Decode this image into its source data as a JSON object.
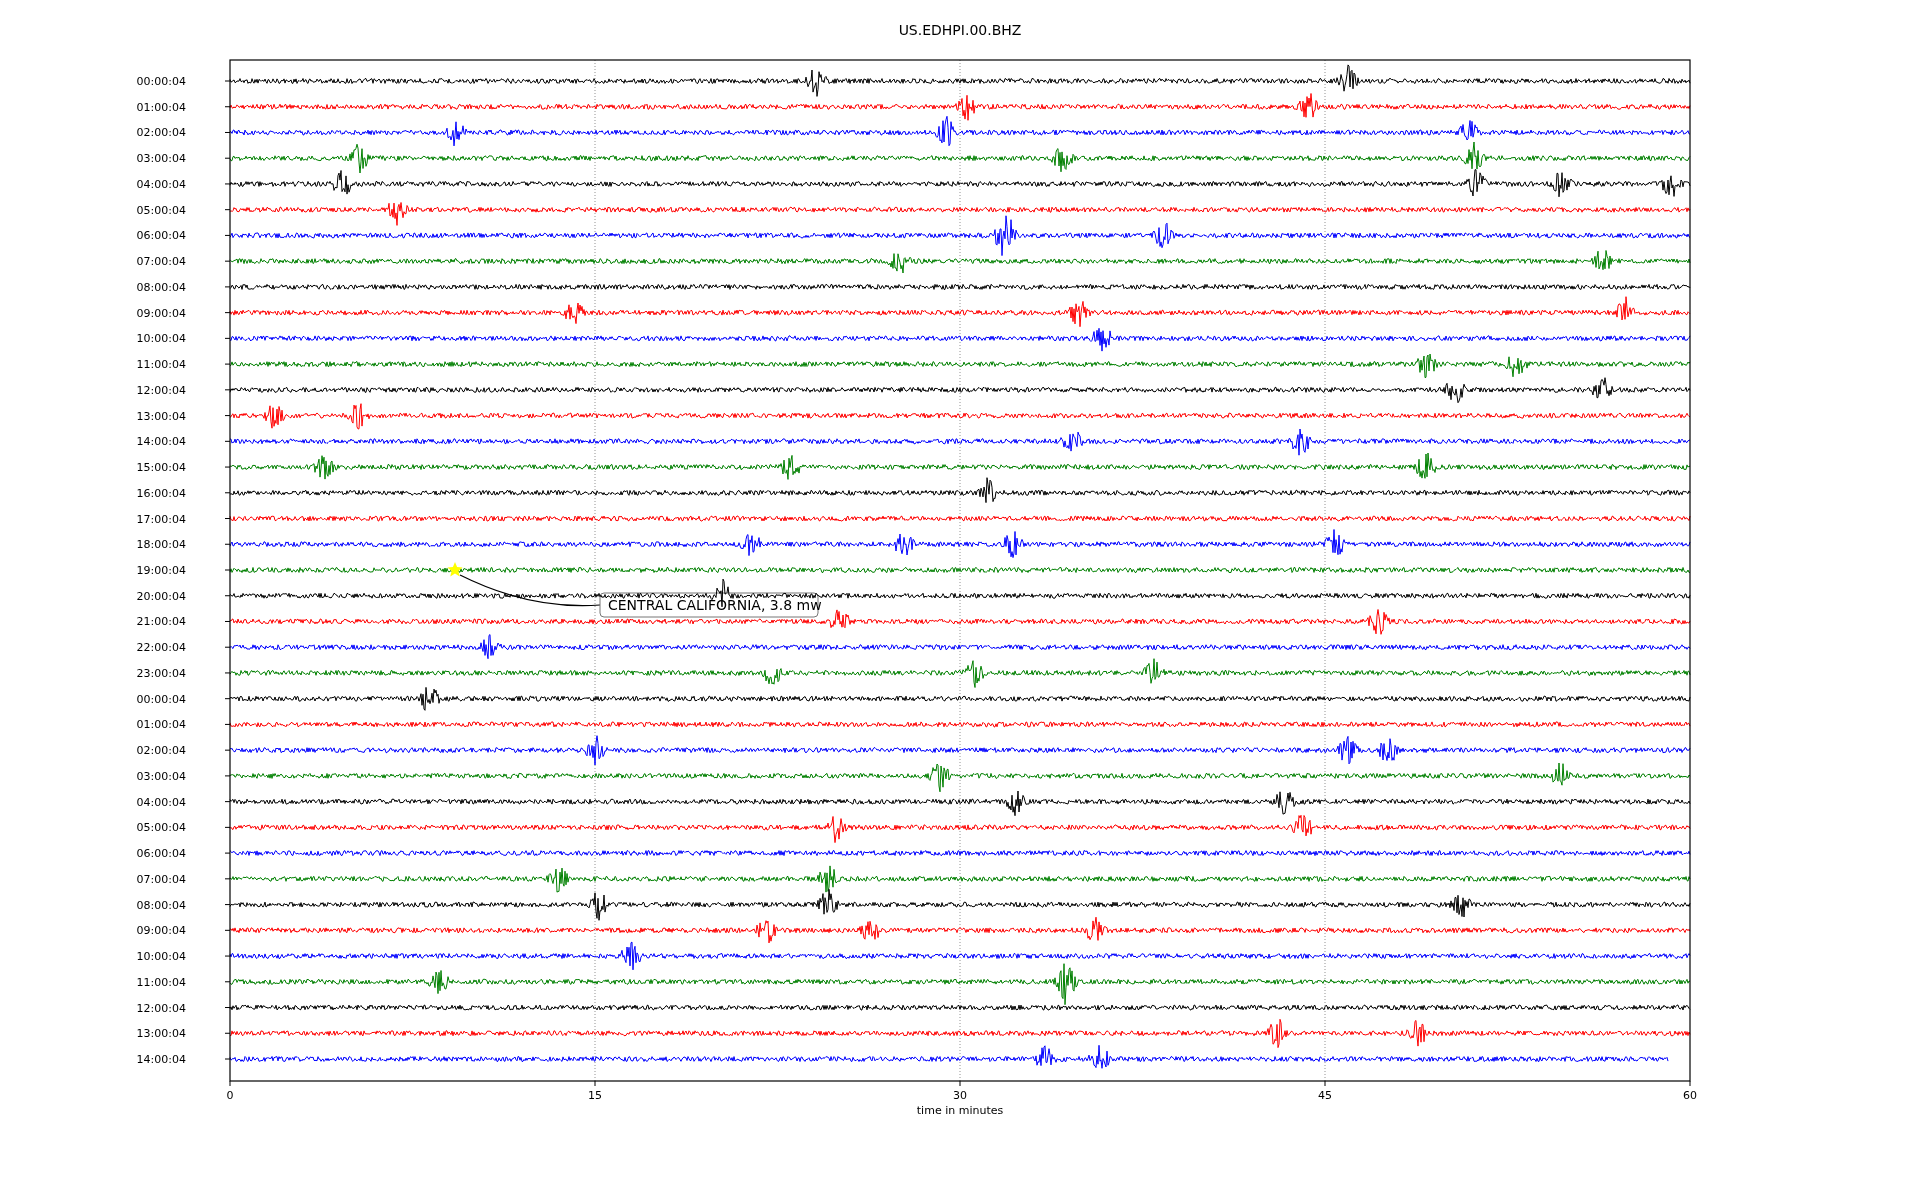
{
  "title": "US.EDHPI.00.BHZ",
  "rows": [
    {
      "label": "00:00:04",
      "color": "#000000"
    },
    {
      "label": "01:00:04",
      "color": "#ff0000"
    },
    {
      "label": "02:00:04",
      "color": "#0000ff"
    },
    {
      "label": "03:00:04",
      "color": "#008000"
    },
    {
      "label": "04:00:04",
      "color": "#000000"
    },
    {
      "label": "05:00:04",
      "color": "#ff0000"
    },
    {
      "label": "06:00:04",
      "color": "#0000ff"
    },
    {
      "label": "07:00:04",
      "color": "#008000"
    },
    {
      "label": "08:00:04",
      "color": "#000000"
    },
    {
      "label": "09:00:04",
      "color": "#ff0000"
    },
    {
      "label": "10:00:04",
      "color": "#0000ff"
    },
    {
      "label": "11:00:04",
      "color": "#008000"
    },
    {
      "label": "12:00:04",
      "color": "#000000"
    },
    {
      "label": "13:00:04",
      "color": "#ff0000"
    },
    {
      "label": "14:00:04",
      "color": "#0000ff"
    },
    {
      "label": "15:00:04",
      "color": "#008000"
    },
    {
      "label": "16:00:04",
      "color": "#000000"
    },
    {
      "label": "17:00:04",
      "color": "#ff0000"
    },
    {
      "label": "18:00:04",
      "color": "#0000ff"
    },
    {
      "label": "19:00:04",
      "color": "#008000",
      "event": "CENTRAL CALIFORNIA, 3.8 mw"
    },
    {
      "label": "20:00:04",
      "color": "#000000"
    },
    {
      "label": "21:00:04",
      "color": "#ff0000"
    },
    {
      "label": "22:00:04",
      "color": "#0000ff"
    },
    {
      "label": "23:00:04",
      "color": "#008000"
    },
    {
      "label": "00:00:04",
      "color": "#000000"
    },
    {
      "label": "01:00:04",
      "color": "#ff0000"
    },
    {
      "label": "02:00:04",
      "color": "#0000ff"
    },
    {
      "label": "03:00:04",
      "color": "#008000"
    },
    {
      "label": "04:00:04",
      "color": "#000000"
    },
    {
      "label": "05:00:04",
      "color": "#ff0000"
    },
    {
      "label": "06:00:04",
      "color": "#0000ff"
    },
    {
      "label": "07:00:04",
      "color": "#008000"
    },
    {
      "label": "08:00:04",
      "color": "#000000"
    },
    {
      "label": "09:00:04",
      "color": "#ff0000"
    },
    {
      "label": "10:00:04",
      "color": "#0000ff"
    },
    {
      "label": "11:00:04",
      "color": "#008000"
    },
    {
      "label": "12:00:04",
      "color": "#000000"
    },
    {
      "label": "13:00:04",
      "color": "#ff0000"
    },
    {
      "label": "14:00:04",
      "color": "#0000ff"
    }
  ],
  "x_ticks": [
    "0",
    "15",
    "30",
    "45",
    "60"
  ],
  "xlabel": "time in minutes"
}
